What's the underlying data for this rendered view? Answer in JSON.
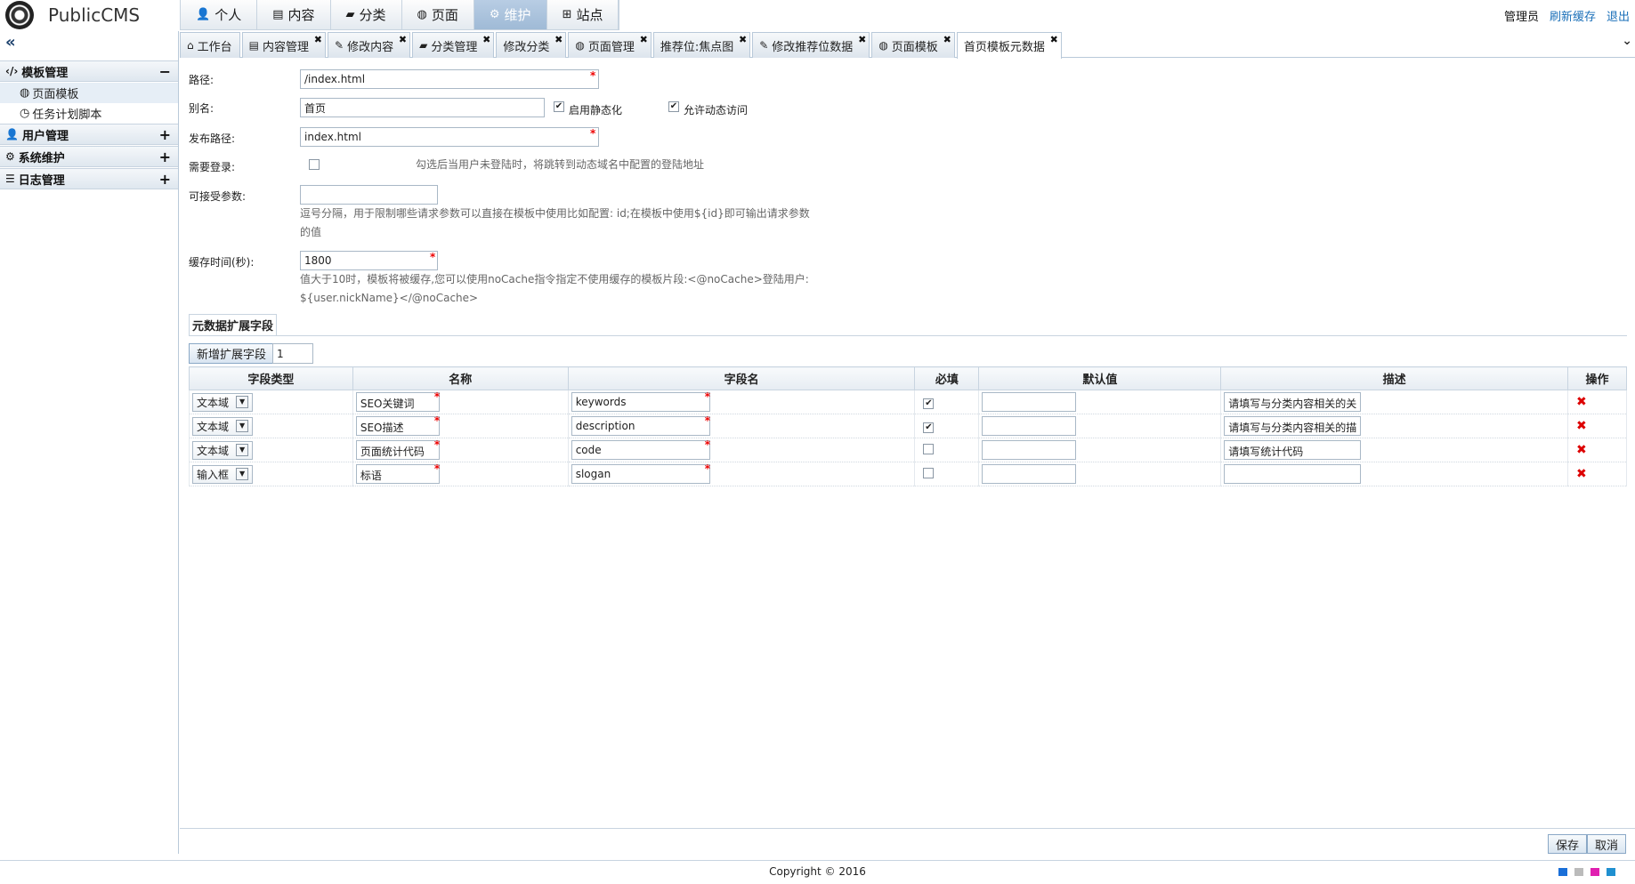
{
  "app": {
    "name": "PublicCMS"
  },
  "topnav": [
    {
      "label": "个人",
      "icon": "user-icon"
    },
    {
      "label": "内容",
      "icon": "book-icon"
    },
    {
      "label": "分类",
      "icon": "folder-icon"
    },
    {
      "label": "页面",
      "icon": "globe-icon"
    },
    {
      "label": "维护",
      "icon": "gear-icon",
      "active": true
    },
    {
      "label": "站点",
      "icon": "sitemap-icon"
    }
  ],
  "topright": {
    "user": "管理员",
    "refresh_cache": "刷新缓存",
    "logout": "退出"
  },
  "tabs": [
    {
      "label": "工作台",
      "icon": "home-icon",
      "closable": false
    },
    {
      "label": "内容管理",
      "icon": "book-icon",
      "closable": true
    },
    {
      "label": "修改内容",
      "icon": "edit-icon",
      "closable": true
    },
    {
      "label": "分类管理",
      "icon": "folder-icon",
      "closable": true
    },
    {
      "label": "修改分类",
      "icon": "",
      "closable": true
    },
    {
      "label": "页面管理",
      "icon": "globe-icon",
      "closable": true
    },
    {
      "label": "推荐位:焦点图",
      "icon": "",
      "closable": true
    },
    {
      "label": "修改推荐位数据",
      "icon": "edit-icon",
      "closable": true
    },
    {
      "label": "页面模板",
      "icon": "globe-icon",
      "closable": true
    },
    {
      "label": "首页模板元数据",
      "icon": "",
      "closable": true,
      "active": true
    }
  ],
  "sidebar": {
    "groups": [
      {
        "label": "模板管理",
        "icon": "code-icon",
        "expanded": true,
        "toggle": "−",
        "items": [
          {
            "label": "页面模板",
            "icon": "globe-icon",
            "selected": true
          },
          {
            "label": "任务计划脚本",
            "icon": "clock-icon"
          }
        ]
      },
      {
        "label": "用户管理",
        "icon": "user-icon",
        "toggle": "+"
      },
      {
        "label": "系统维护",
        "icon": "cogs-icon",
        "toggle": "+"
      },
      {
        "label": "日志管理",
        "icon": "list-icon",
        "toggle": "+"
      }
    ]
  },
  "form": {
    "path_label": "路径:",
    "path_value": "/index.html",
    "alias_label": "别名:",
    "alias_value": "首页",
    "static_label": "启用静态化",
    "static_checked": true,
    "dynamic_label": "允许动态访问",
    "dynamic_checked": true,
    "publish_label": "发布路径:",
    "publish_value": "index.html",
    "login_label": "需要登录:",
    "login_checked": false,
    "login_hint": "勾选后当用户未登陆时，将跳转到动态域名中配置的登陆地址",
    "params_label": "可接受参数:",
    "params_value": "",
    "params_hint_1": "逗号分隔，用于限制哪些请求参数可以直接在模板中使用比如配置: id;在模板中使用${id}即可输出请求参数",
    "params_hint_2": "的值",
    "cache_label": "缓存时间(秒):",
    "cache_value": "1800",
    "cache_hint_1": "值大于10时，模板将被缓存,您可以使用noCache指令指定不使用缓存的模板片段:<@noCache>登陆用户:",
    "cache_hint_2": "${user.nickName}</@noCache>"
  },
  "meta": {
    "section_title": "元数据扩展字段",
    "add_button": "新增扩展字段",
    "add_count": "1",
    "columns": [
      "字段类型",
      "名称",
      "字段名",
      "必填",
      "默认值",
      "描述",
      "操作"
    ],
    "rows": [
      {
        "type": "文本域",
        "name": "SEO关键词",
        "field": "keywords",
        "required": true,
        "default": "",
        "desc": "请填写与分类内容相关的关"
      },
      {
        "type": "文本域",
        "name": "SEO描述",
        "field": "description",
        "required": true,
        "default": "",
        "desc": "请填写与分类内容相关的描"
      },
      {
        "type": "文本域",
        "name": "页面统计代码",
        "field": "code",
        "required": false,
        "default": "",
        "desc": "请填写统计代码"
      },
      {
        "type": "输入框",
        "name": "标语",
        "field": "slogan",
        "required": false,
        "default": "",
        "desc": ""
      }
    ]
  },
  "buttons": {
    "save": "保存",
    "cancel": "取消"
  },
  "footer": {
    "copyright": "Copyright © 2016"
  },
  "themes": [
    "#1a6fd8",
    "#bbbbbb",
    "#e020b0",
    "#2090d0"
  ]
}
